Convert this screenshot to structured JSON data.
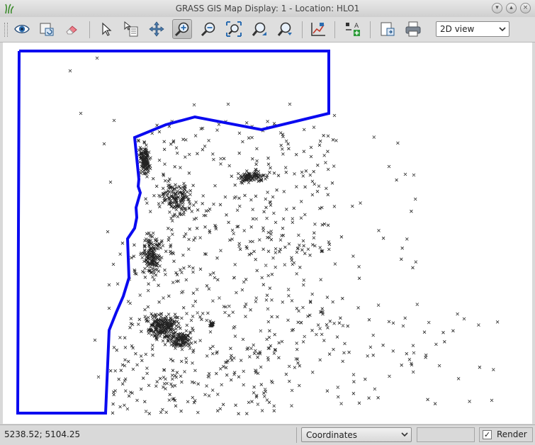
{
  "window": {
    "title": "GRASS GIS Map Display: 1  - Location: HLO1",
    "buttons": [
      "minimize",
      "maximize",
      "close"
    ]
  },
  "toolbar": {
    "buttons": [
      {
        "name": "display-map-icon",
        "tooltip": "Display map"
      },
      {
        "name": "render-map-icon",
        "tooltip": "Render map"
      },
      {
        "name": "erase-icon",
        "tooltip": "Erase display"
      },
      {
        "name": "pointer-icon",
        "tooltip": "Pointer"
      },
      {
        "name": "query-icon",
        "tooltip": "Query raster/vector map(s)"
      },
      {
        "name": "pan-icon",
        "tooltip": "Pan"
      },
      {
        "name": "zoom-in-icon",
        "tooltip": "Zoom in",
        "active": true
      },
      {
        "name": "zoom-out-icon",
        "tooltip": "Zoom out"
      },
      {
        "name": "zoom-extent-icon",
        "tooltip": "Zoom to selected map layer(s)"
      },
      {
        "name": "zoom-back-icon",
        "tooltip": "Return to previous zoom"
      },
      {
        "name": "zoom-menu-icon",
        "tooltip": "Zoom options"
      },
      {
        "name": "analyze-icon",
        "tooltip": "Analyze map"
      },
      {
        "name": "decorations-icon",
        "tooltip": "Add map elements"
      },
      {
        "name": "save-display-icon",
        "tooltip": "Save display to graphic file"
      },
      {
        "name": "print-icon",
        "tooltip": "Print display"
      }
    ],
    "view_select": {
      "value": "2D view"
    }
  },
  "map": {
    "boundary_color": "#0a0af0",
    "point_color": "#222222"
  },
  "statusbar": {
    "coordinates": "5238.52; 5104.25",
    "mode_select": "Coordinates",
    "render_label": "Render",
    "render_checked": true
  }
}
